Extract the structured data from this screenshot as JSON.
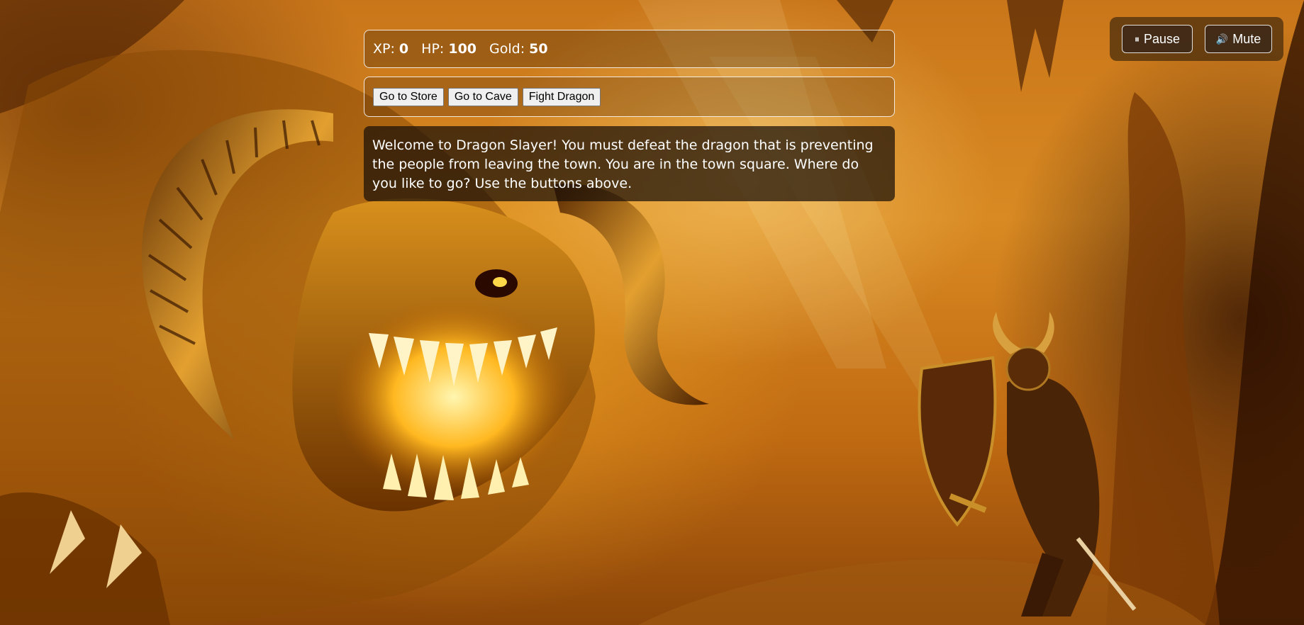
{
  "stats": {
    "xp_label": "XP:",
    "xp_value": "0",
    "hp_label": "HP:",
    "hp_value": "100",
    "gold_label": "Gold:",
    "gold_value": "50"
  },
  "controls": {
    "button1": "Go to Store",
    "button2": "Go to Cave",
    "button3": "Fight Dragon"
  },
  "message": "Welcome to Dragon Slayer! You must defeat the dragon that is preventing the people from leaving the town. You are in the town square. Where do you like to go? Use the buttons above.",
  "toolbar": {
    "pause_icon": "⏸",
    "pause_label": "Pause",
    "mute_icon": "🔊",
    "mute_label": "Mute"
  }
}
